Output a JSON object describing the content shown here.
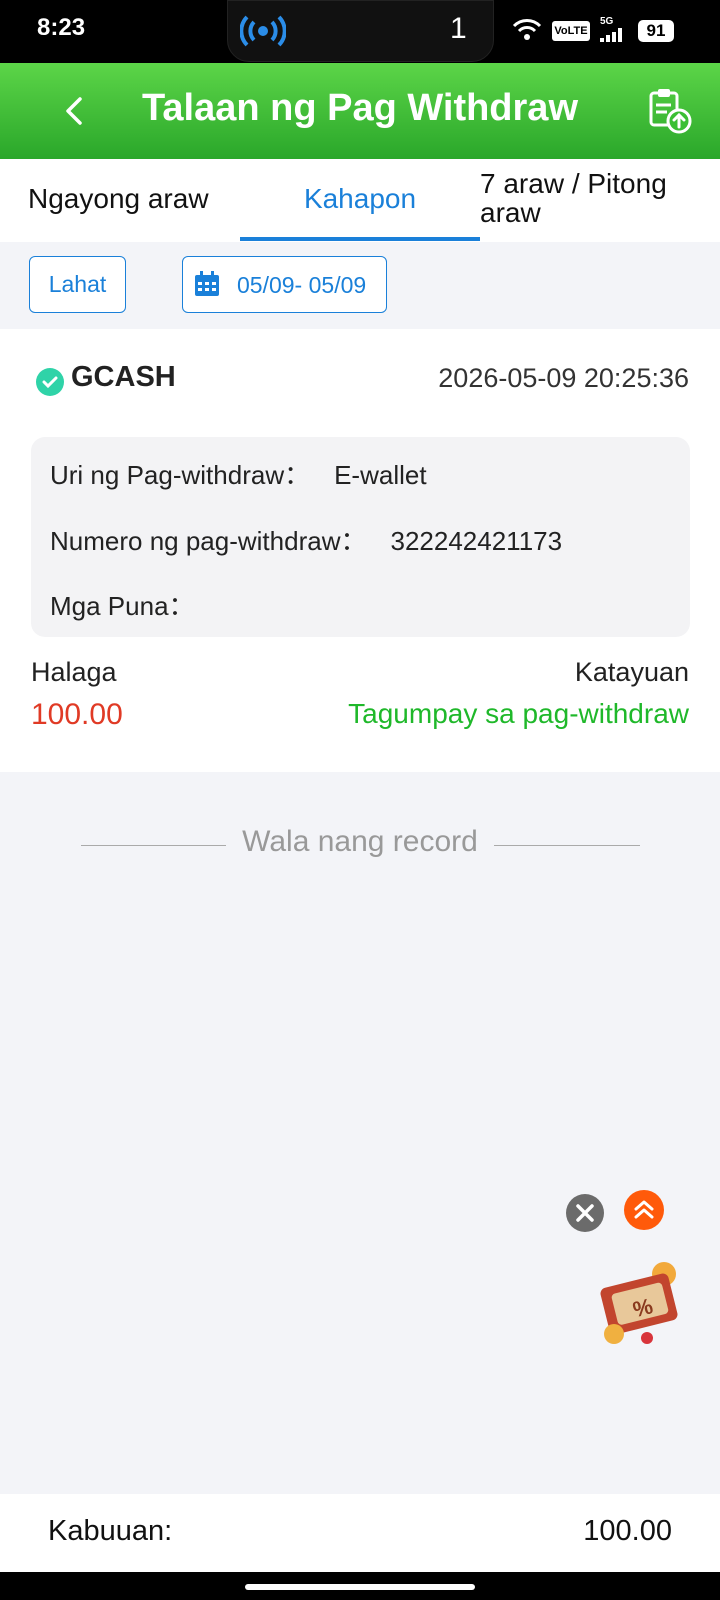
{
  "status_bar": {
    "time": "8:23",
    "notification_count": "1",
    "volte": "VoLTE",
    "network": "5G",
    "battery": "91"
  },
  "header": {
    "title": "Talaan ng Pag Withdraw"
  },
  "tabs": [
    {
      "label": "Ngayong araw",
      "active": false
    },
    {
      "label": "Kahapon",
      "active": true
    },
    {
      "label_line1": "7 araw / Pitong",
      "label_line2": "araw",
      "active": false
    }
  ],
  "filter": {
    "all_label": "Lahat",
    "date_range": "05/09- 05/09"
  },
  "record": {
    "provider": "GCASH",
    "datetime": "2026-05-09 20:25:36",
    "type_label": "Uri ng Pag-withdraw：",
    "type_value": "E-wallet",
    "number_label": "Numero ng pag-withdraw：",
    "number_value": "322242421173",
    "remarks_label": "Mga Puna：",
    "remarks_value": "",
    "amount_label": "Halaga",
    "amount_value": "100.00",
    "status_label": "Katayuan",
    "status_value": "Tagumpay sa pag-withdraw"
  },
  "no_more": "Wala nang record",
  "footer": {
    "total_label": "Kabuuan:",
    "total_value": "100.00"
  },
  "colors": {
    "header_green": "#3bbf33",
    "accent_blue": "#1a80d9",
    "amount_red": "#e03a25",
    "success_green": "#1fb82a",
    "fab_orange": "#ff5a0a"
  }
}
